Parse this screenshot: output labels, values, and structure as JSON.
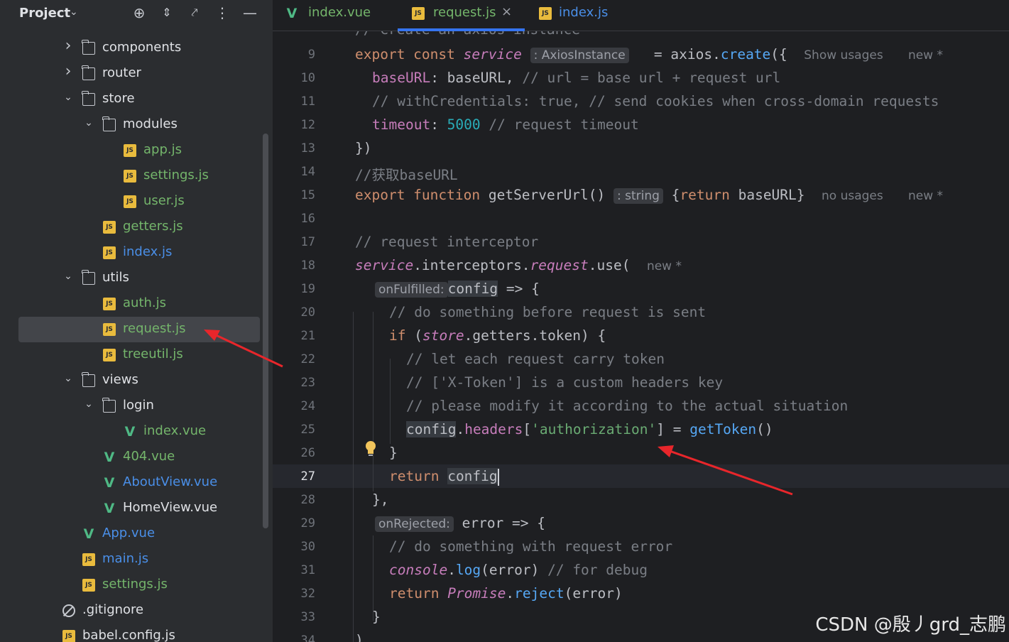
{
  "project_panel": {
    "title": "Project",
    "tree": [
      {
        "label": "components",
        "type": "folder",
        "expanded": false,
        "depth": 0
      },
      {
        "label": "router",
        "type": "folder",
        "expanded": false,
        "depth": 0
      },
      {
        "label": "store",
        "type": "folder",
        "expanded": true,
        "depth": 0
      },
      {
        "label": "modules",
        "type": "folder",
        "expanded": true,
        "depth": 1
      },
      {
        "label": "app.js",
        "type": "js",
        "depth": 2,
        "color": "green"
      },
      {
        "label": "settings.js",
        "type": "js",
        "depth": 2,
        "color": "green"
      },
      {
        "label": "user.js",
        "type": "js",
        "depth": 2,
        "color": "green"
      },
      {
        "label": "getters.js",
        "type": "js",
        "depth": 1,
        "color": "green"
      },
      {
        "label": "index.js",
        "type": "js",
        "depth": 1,
        "color": "blue"
      },
      {
        "label": "utils",
        "type": "folder",
        "expanded": true,
        "depth": 0
      },
      {
        "label": "auth.js",
        "type": "js",
        "depth": 1,
        "color": "green"
      },
      {
        "label": "request.js",
        "type": "js",
        "depth": 1,
        "color": "green",
        "selected": true
      },
      {
        "label": "treeutil.js",
        "type": "js",
        "depth": 1,
        "color": "green"
      },
      {
        "label": "views",
        "type": "folder",
        "expanded": true,
        "depth": 0
      },
      {
        "label": "login",
        "type": "folder",
        "expanded": true,
        "depth": 1
      },
      {
        "label": "index.vue",
        "type": "vue",
        "depth": 2,
        "color": "green"
      },
      {
        "label": "404.vue",
        "type": "vue",
        "depth": 1,
        "color": "green"
      },
      {
        "label": "AboutView.vue",
        "type": "vue",
        "depth": 1,
        "color": "blue"
      },
      {
        "label": "HomeView.vue",
        "type": "vue",
        "depth": 1,
        "color": "plain"
      },
      {
        "label": "App.vue",
        "type": "vue",
        "depth": -1,
        "color": "blue"
      },
      {
        "label": "main.js",
        "type": "js",
        "depth": -1,
        "color": "blue"
      },
      {
        "label": "settings.js",
        "type": "js",
        "depth": -1,
        "color": "green"
      },
      {
        "label": ".gitignore",
        "type": "ignore",
        "depth": -2,
        "color": "plain"
      },
      {
        "label": "babel.config.js",
        "type": "js",
        "depth": -2,
        "color": "plain"
      }
    ]
  },
  "tabs": [
    {
      "label": "index.vue",
      "type": "vue",
      "color": "green",
      "active": false
    },
    {
      "label": "request.js",
      "type": "js",
      "color": "green",
      "active": true
    },
    {
      "label": "index.js",
      "type": "js",
      "color": "blue",
      "active": false
    }
  ],
  "colors": {
    "accent": "#3574f0",
    "selection": "#43454a",
    "annotation_arrow": "#e8262b"
  },
  "editor": {
    "current_line": "27",
    "line_numbers": [
      "9",
      "10",
      "11",
      "12",
      "13",
      "14",
      "15",
      "16",
      "17",
      "18",
      "19",
      "20",
      "21",
      "22",
      "23",
      "24",
      "25",
      "26",
      "27",
      "28",
      "29",
      "30",
      "31",
      "32",
      "33",
      "34"
    ],
    "top_partial": "// Create an axios instance",
    "code": {
      "l9_export": "export const ",
      "l9_service": "service",
      "l9_hint": ": AxiosInstance",
      "l9_eq": " = axios.",
      "l9_create": "create",
      "l9_brace": "({",
      "l9_usages": "Show usages",
      "l9_new": "new *",
      "l10_key": "baseURL",
      "l10_rest": ": baseURL, ",
      "l10_cm": "// url = base url + request url",
      "l11_cm": "// withCredentials: true, // send cookies when cross-domain requests",
      "l12_key": "timeout",
      "l12_colon": ": ",
      "l12_num": "5000",
      "l12_cm": " // request timeout",
      "l13": "})",
      "l14_cm": "//获取baseURL",
      "l15_export": "export function ",
      "l15_name": "getServerUrl",
      "l15_paren": "()",
      "l15_hint": ": string",
      "l15_body_a": "{",
      "l15_return": "return",
      "l15_body_b": " baseURL}",
      "l15_usages": "no usages",
      "l15_new": "new *",
      "l17_cm": "// request interceptor",
      "l18_service": "service",
      "l18_dot1": ".interceptors.",
      "l18_request": "request",
      "l18_use": ".use(",
      "l18_new": "new *",
      "l19_hint": "onFulfilled:",
      "l19_config": "config",
      "l19_arrow": " => {",
      "l20_cm": "// do something before request is sent",
      "l21_if": "if",
      "l21_open": " (",
      "l21_store": "store",
      "l21_getters": ".getters.token) {",
      "l22_cm": "// let each request carry token",
      "l23_cm": "// ['X-Token'] is a custom headers key",
      "l24_cm": "// please modify it according to the actual situation",
      "l25_config": "config",
      "l25_dot": ".",
      "l25_headers": "headers",
      "l25_bracket": "[",
      "l25_str": "'authorization'",
      "l25_eq": "] = ",
      "l25_fn": "getToken",
      "l25_paren": "()",
      "l26": "}",
      "l27_return": "return",
      "l27_config": "config",
      "l28": "},",
      "l29_hint": "onRejected:",
      "l29_error": " error => {",
      "l30_cm": "// do something with request error",
      "l31_console": "console",
      "l31_dot": ".",
      "l31_log": "log",
      "l31_args": "(error) ",
      "l31_cm": "// for debug",
      "l32_return": "return ",
      "l32_promise": "Promise",
      "l32_dot": ".",
      "l32_reject": "reject",
      "l32_args": "(error)",
      "l33": "}",
      "l34": ")"
    }
  },
  "watermark": "CSDN @殷丿grd_志鹏"
}
